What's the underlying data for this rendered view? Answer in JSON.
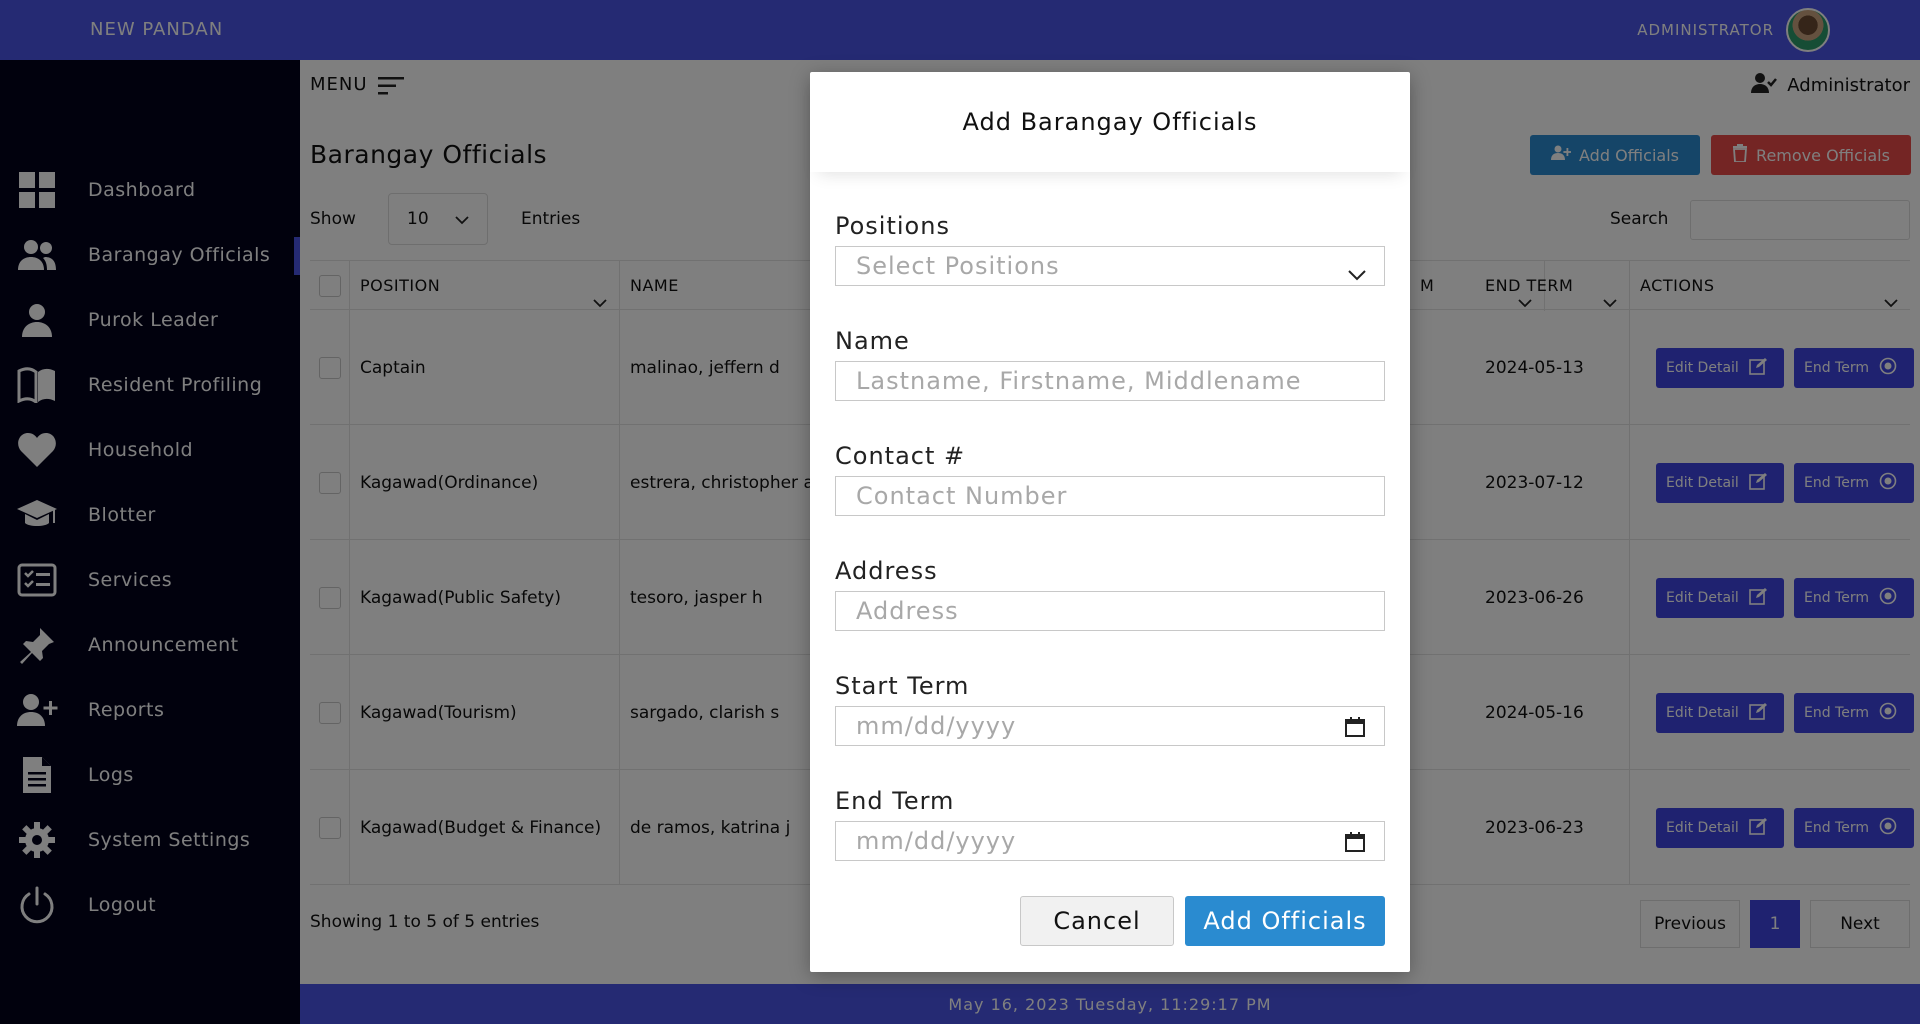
{
  "header": {
    "brand": "NEW PANDAN",
    "user_label": "ADMINISTRATOR"
  },
  "sidebar": {
    "items": [
      {
        "label": "Dashboard",
        "icon": "dashboard-grid-icon"
      },
      {
        "label": "Barangay Officials",
        "icon": "users-icon"
      },
      {
        "label": "Purok Leader",
        "icon": "user-icon"
      },
      {
        "label": "Resident Profiling",
        "icon": "book-icon"
      },
      {
        "label": "Household",
        "icon": "heart-icon"
      },
      {
        "label": "Blotter",
        "icon": "graduation-cap-icon"
      },
      {
        "label": "Services",
        "icon": "checklist-icon"
      },
      {
        "label": "Announcement",
        "icon": "pin-icon"
      },
      {
        "label": "Reports",
        "icon": "user-plus-icon"
      },
      {
        "label": "Logs",
        "icon": "document-icon"
      },
      {
        "label": "System Settings",
        "icon": "gear-icon"
      },
      {
        "label": "Logout",
        "icon": "power-icon"
      }
    ],
    "active": "Barangay Officials"
  },
  "main": {
    "menu_label": "MENU",
    "admin_label": "Administrator",
    "page_title": "Barangay Officials",
    "add_button": "Add Officials",
    "remove_button": "Remove Officials",
    "show_label": "Show",
    "entries_value": "10",
    "entries_label": "Entries",
    "search_label": "Search",
    "columns": [
      "POSITION",
      "NAME",
      "M",
      "END TERM",
      "ACTIONS"
    ],
    "rows": [
      {
        "position": "Captain",
        "name": "malinao, jeffern d",
        "end_term": "2024-05-13"
      },
      {
        "position": "Kagawad(Ordinance)",
        "name": "estrera, christopher a",
        "end_term": "2023-07-12"
      },
      {
        "position": "Kagawad(Public Safety)",
        "name": "tesoro, jasper h",
        "end_term": "2023-06-26"
      },
      {
        "position": "Kagawad(Tourism)",
        "name": "sargado, clarish s",
        "end_term": "2024-05-16"
      },
      {
        "position": "Kagawad(Budget & Finance)",
        "name": "de ramos, katrina j",
        "end_term": "2023-06-23"
      }
    ],
    "edit_label": "Edit Detail",
    "end_label": "End Term",
    "showing": "Showing 1 to 5 of 5 entries",
    "pagination": {
      "previous": "Previous",
      "page": "1",
      "next": "Next"
    }
  },
  "footer": {
    "datetime": "May 16, 2023 Tuesday, 11:29:17 PM"
  },
  "modal": {
    "title": "Add Barangay Officials",
    "positions_label": "Positions",
    "positions_placeholder": "Select Positions",
    "name_label": "Name",
    "name_placeholder": "Lastname, Firstname, Middlename",
    "contact_label": "Contact #",
    "contact_placeholder": "Contact Number",
    "address_label": "Address",
    "address_placeholder": "Address",
    "start_label": "Start Term",
    "start_placeholder": "mm/dd/yyyy",
    "end_label": "End Term",
    "end_placeholder": "mm/dd/yyyy",
    "cancel": "Cancel",
    "submit": "Add Officials"
  },
  "colors": {
    "topbar": "#4b55e6",
    "sidebar": "#02031b",
    "primary_button": "#2a8bd0",
    "danger_button": "#e84a48",
    "action_button": "#3f45e0"
  }
}
